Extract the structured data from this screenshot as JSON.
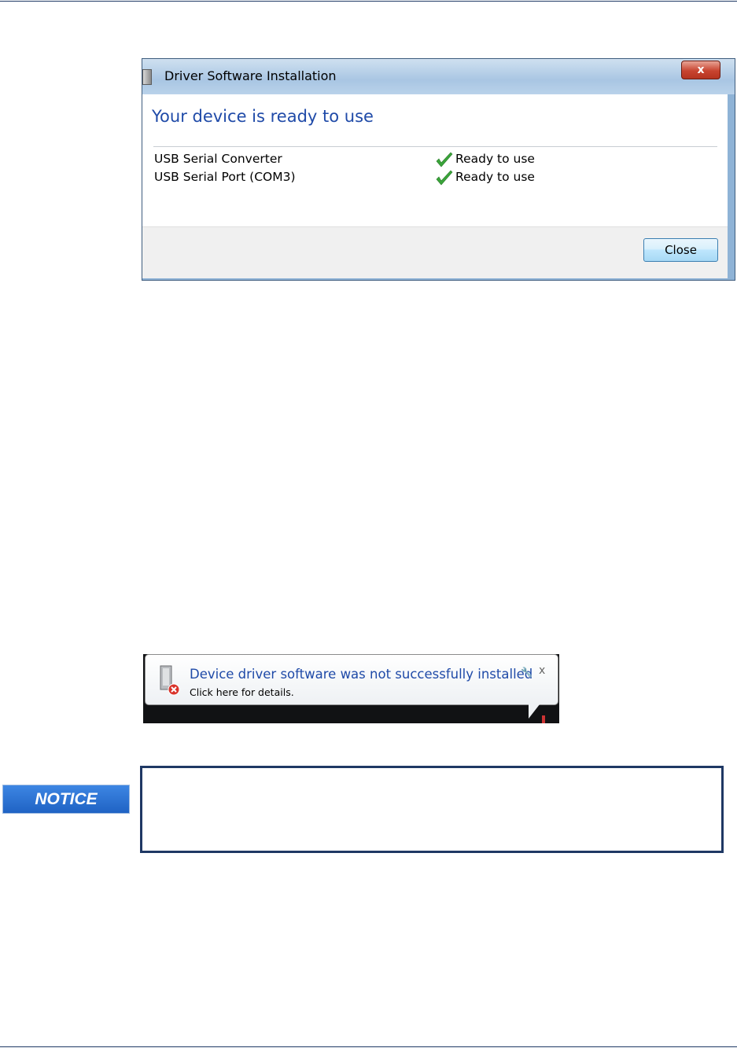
{
  "dialog": {
    "title": "Driver Software Installation",
    "close_glyph": "x",
    "heading": "Your device is ready to use",
    "devices": [
      {
        "name": "USB Serial Converter",
        "status": "Ready to use"
      },
      {
        "name": "USB Serial Port (COM3)",
        "status": "Ready to use"
      }
    ],
    "close_button": "Close"
  },
  "balloon": {
    "title": "Device driver software was not successfully installed",
    "subtitle": "Click here for details.",
    "wrench_glyph": "🔧",
    "close_glyph": "x"
  },
  "notice": {
    "label": "NOTICE",
    "body": ""
  },
  "colors": {
    "heading_blue": "#1f4aa8",
    "notice_blue": "#1f63c4",
    "notice_border": "#1f3864",
    "check_green": "#3aa53a"
  }
}
